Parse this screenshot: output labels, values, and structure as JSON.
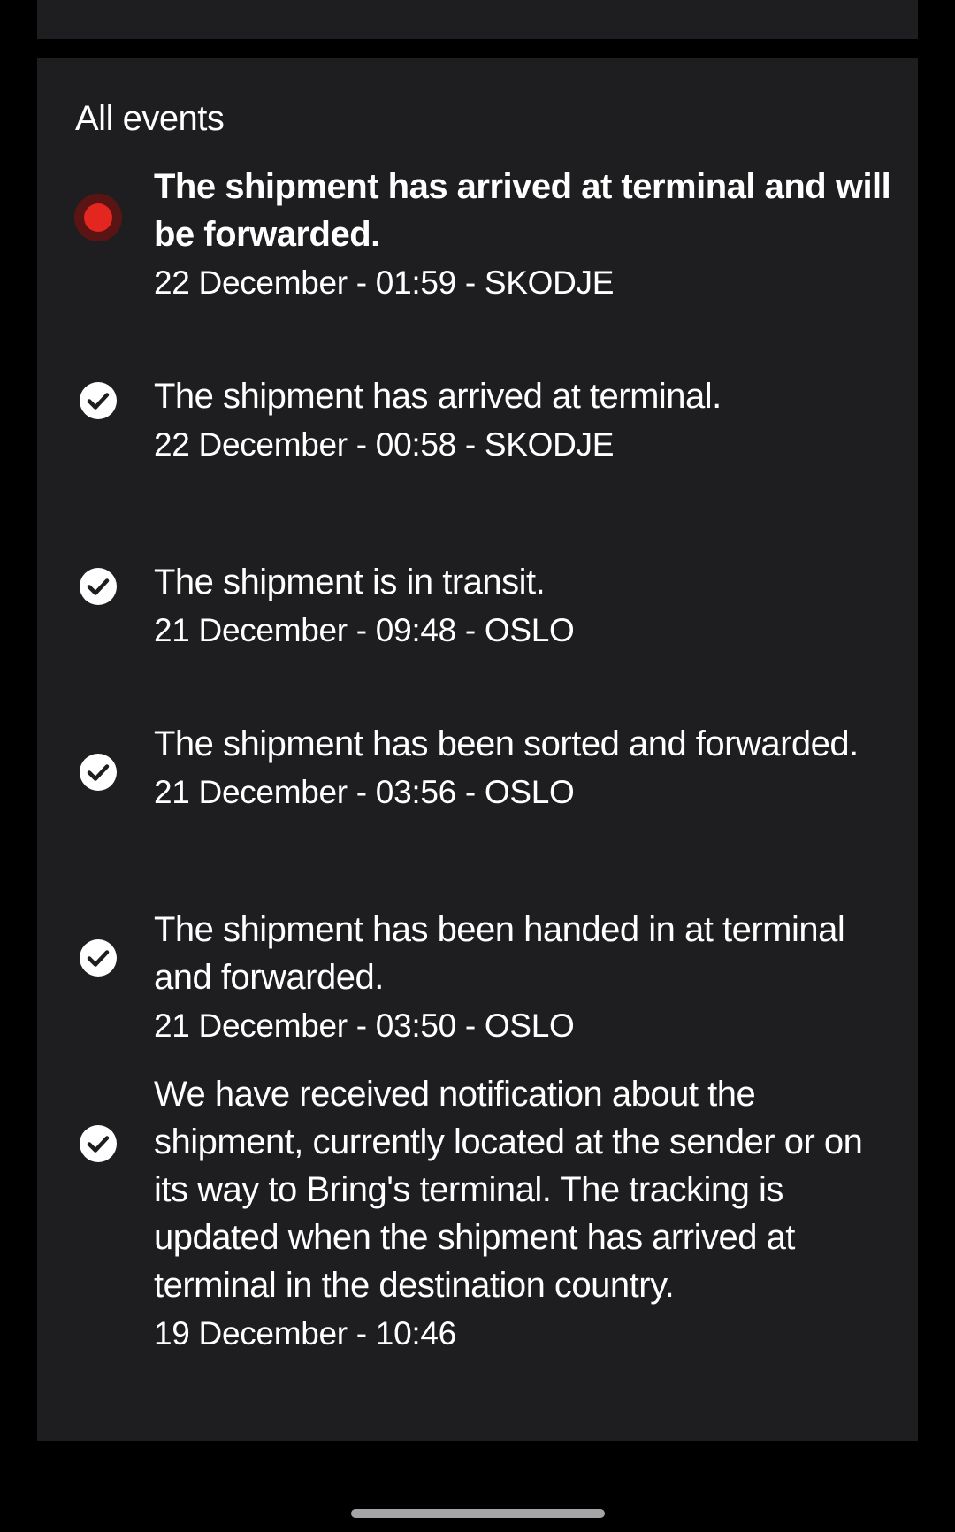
{
  "section": {
    "heading": "All events"
  },
  "events": [
    {
      "title": "The shipment has arrived at terminal and will be forwarded.",
      "meta": "22 December - 01:59 - SKODJE",
      "status": "current",
      "icon": "current-dot-icon"
    },
    {
      "title": "The shipment has arrived at terminal.",
      "meta": "22 December - 00:58 - SKODJE",
      "status": "done",
      "icon": "check-circle-icon"
    },
    {
      "title": "The shipment is in transit.",
      "meta": "21 December - 09:48 - OSLO",
      "status": "done",
      "icon": "check-circle-icon"
    },
    {
      "title": "The shipment has been sorted and forwarded.",
      "meta": "21 December - 03:56 - OSLO",
      "status": "done",
      "icon": "check-circle-icon"
    },
    {
      "title": "The shipment has been handed in at terminal and forwarded.",
      "meta": "21 December - 03:50 - OSLO",
      "status": "done",
      "icon": "check-circle-icon"
    },
    {
      "title": "We have received notification about the shipment, currently located at the sender or on its way to Bring's terminal. The tracking is updated when the shipment has arrived at terminal in the destination country.",
      "meta": "19 December - 10:46",
      "status": "done",
      "icon": "check-circle-icon"
    }
  ],
  "colors": {
    "background": "#000000",
    "card": "#1e1e20",
    "text": "#ffffff",
    "current_dot": "#e3261f",
    "current_ring": "#5a1414"
  }
}
